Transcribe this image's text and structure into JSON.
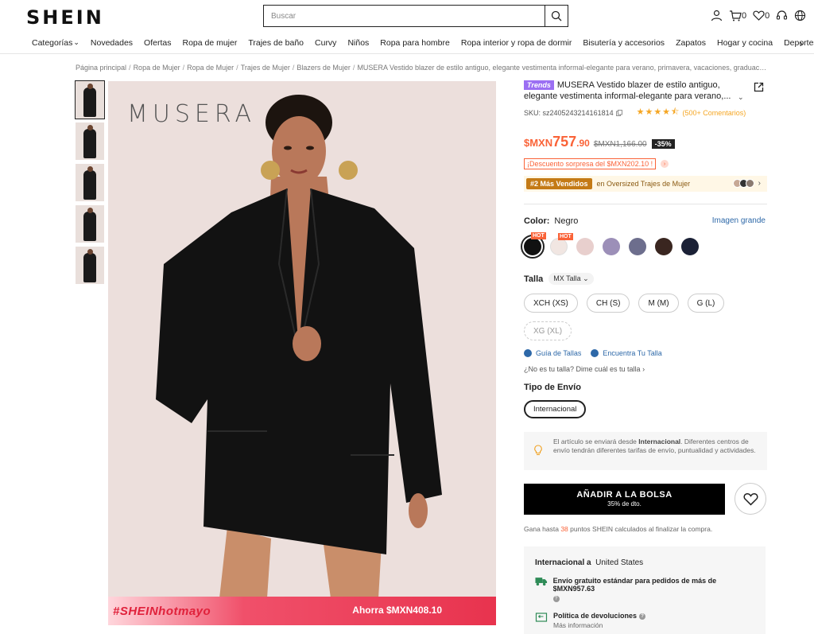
{
  "header": {
    "logo": "SHEIN",
    "search_placeholder": "Buscar",
    "cart_count": "0",
    "wishlist_count": "0"
  },
  "nav": {
    "items": [
      "Categorías",
      "Novedades",
      "Ofertas",
      "Ropa de mujer",
      "Trajes de baño",
      "Curvy",
      "Niños",
      "Ropa para hombre",
      "Ropa interior y ropa de dormir",
      "Bisutería y accesorios",
      "Zapatos",
      "Hogar y cocina",
      "Deportes y c"
    ]
  },
  "breadcrumb": [
    "Página principal",
    "Ropa de Mujer",
    "Ropa de Mujer",
    "Trajes de Mujer",
    "Blazers de Mujer",
    "MUSERA Vestido blazer de estilo antiguo, elegante vestimenta informal-elegante para verano, primavera, vacaciones, graduación, fies..."
  ],
  "gallery": {
    "brand_watermark": "MUSERA",
    "promo_tag": "#SHEINhotmayo",
    "promo_save": "Ahorra $MXN408.10"
  },
  "product": {
    "trend_badge": "Trends",
    "title": "MUSERA Vestido blazer de estilo antiguo, elegante vestimenta informal-elegante para verano,...",
    "sku": "SKU: sz2405243214161814",
    "rating": 4.5,
    "reviews": "(500+ Comentarios)",
    "price_currency": "$MXN",
    "price_main": "757",
    "price_decimals": ".90",
    "price_old": "$MXN1,166.00",
    "discount": "-35%",
    "surprise_discount": "¡Descuento sorpresa del $MXN202.10 !",
    "bestseller_badge": "#2 Más Vendidos",
    "bestseller_text": "en Oversized Trajes de Mujer"
  },
  "color": {
    "label": "Color:",
    "value": "Negro",
    "big_image_link": "Imagen grande",
    "hot_label": "HOT",
    "swatches": [
      {
        "color": "#111111",
        "hot": true,
        "active": true
      },
      {
        "color": "#f1e6e2",
        "hot": true,
        "active": false
      },
      {
        "color": "#e8cfcd",
        "hot": false,
        "active": false
      },
      {
        "color": "#9c8fb8",
        "hot": false,
        "active": false
      },
      {
        "color": "#6d6e8d",
        "hot": false,
        "active": false
      },
      {
        "color": "#3a2620",
        "hot": false,
        "active": false
      },
      {
        "color": "#1b2136",
        "hot": false,
        "active": false
      }
    ]
  },
  "size": {
    "label": "Talla",
    "system": "MX Talla",
    "options": [
      {
        "label": "XCH (XS)",
        "available": true
      },
      {
        "label": "CH (S)",
        "available": true
      },
      {
        "label": "M (M)",
        "available": true
      },
      {
        "label": "G (L)",
        "available": true
      },
      {
        "label": "XG (XL)",
        "available": false
      }
    ],
    "guide_link": "Guía de Tallas",
    "find_link": "Encuentra Tu Talla",
    "ask": "¿No es tu talla? Dime cuál es tu talla"
  },
  "shipping": {
    "type_label": "Tipo de Envío",
    "option": "Internacional",
    "info_prefix": "El artículo se enviará desde ",
    "info_bold": "Internacional",
    "info_rest": ". Diferentes centros de envío tendrán diferentes tarifas de envío, puntualidad y actividades."
  },
  "cart": {
    "button": "AÑADIR A LA BOLSA",
    "sub": "35% de dto.",
    "points_prefix": "Gana hasta ",
    "points_num": "38",
    "points_suffix": " puntos SHEIN calculados al finalizar la compra."
  },
  "delivery": {
    "title_bold": "Internacional a",
    "title_dest": "United States",
    "free_shipping": "Envío gratuito estándar para pedidos de más de $MXN957.63",
    "returns": "Política de devoluciones",
    "more_info": "Más información"
  }
}
